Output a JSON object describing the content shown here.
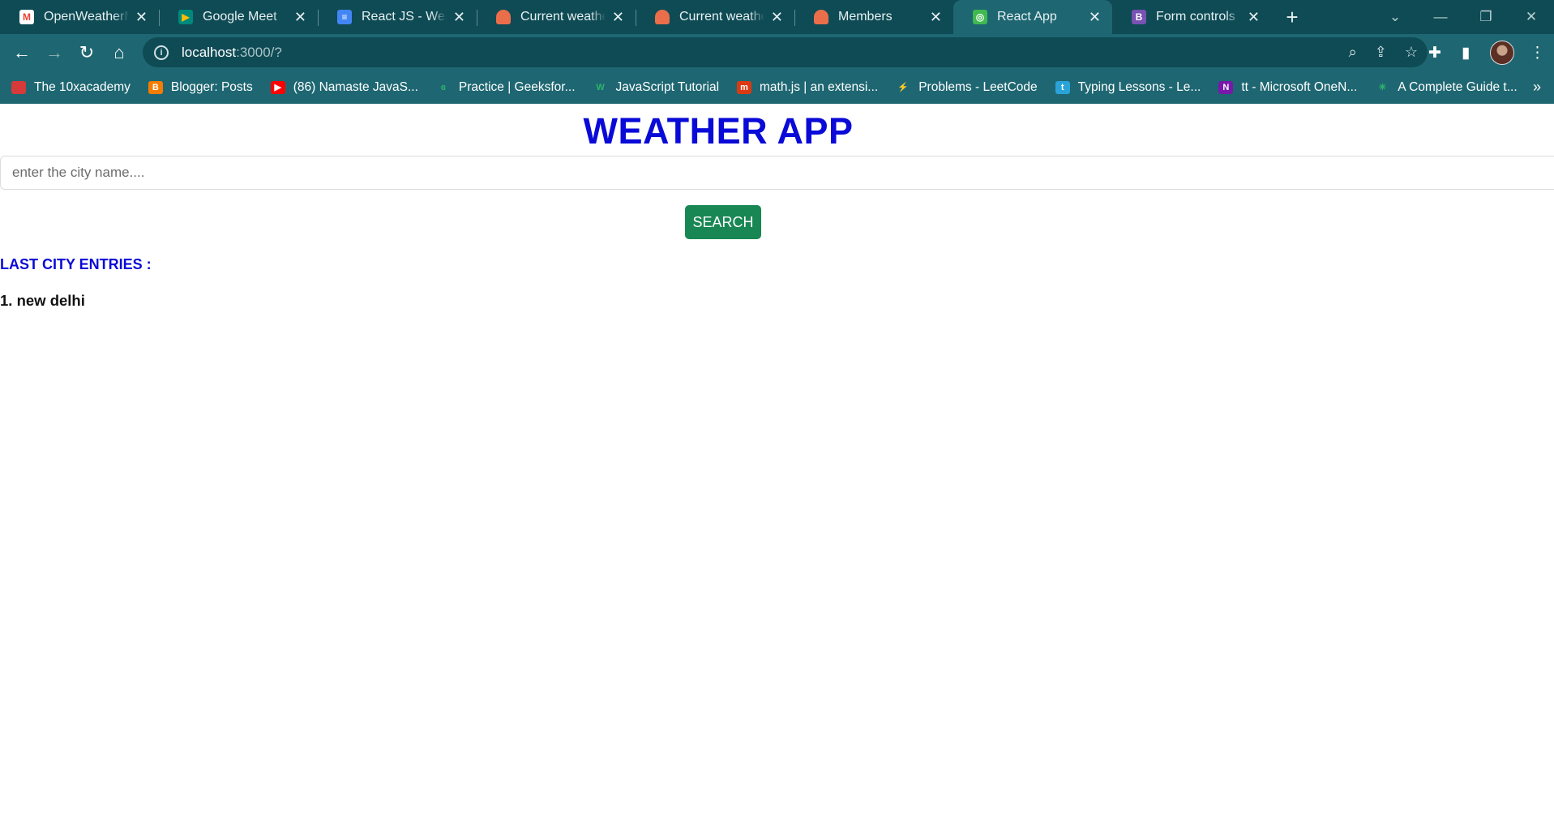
{
  "browser": {
    "tabs": [
      {
        "title": "OpenWeatherMap",
        "favicon": "gmail-icon",
        "color": "#ffffff",
        "glyph": "M",
        "glyph_color": "#ea4335",
        "active": false
      },
      {
        "title": "Google Meet",
        "favicon": "google-meet-icon",
        "color": "#00897b",
        "glyph": "▶",
        "glyph_color": "#fbbc04",
        "active": false
      },
      {
        "title": "React JS - Weather",
        "favicon": "google-docs-icon",
        "color": "#4285f4",
        "glyph": "≡",
        "glyph_color": "#ffffff",
        "active": false
      },
      {
        "title": "Current weather data",
        "favicon": "openweather-icon",
        "color": "#eb6e4b",
        "glyph": "",
        "glyph_color": "#ffffff",
        "active": false
      },
      {
        "title": "Current weather data",
        "favicon": "openweather-icon",
        "color": "#eb6e4b",
        "glyph": "",
        "glyph_color": "#ffffff",
        "active": false
      },
      {
        "title": "Members",
        "favicon": "openweather-icon",
        "color": "#eb6e4b",
        "glyph": "",
        "glyph_color": "#ffffff",
        "active": false
      },
      {
        "title": "React App",
        "favicon": "react-app-icon",
        "color": "#3fb950",
        "glyph": "◎",
        "glyph_color": "#ffffff",
        "active": true
      },
      {
        "title": "Form controls · Bootstrap",
        "favicon": "bootstrap-icon",
        "color": "#7952b3",
        "glyph": "B",
        "glyph_color": "#ffffff",
        "active": false
      }
    ],
    "url_host": "localhost",
    "url_rest": ":3000/?",
    "bookmarks": [
      {
        "label": "The 10xacademy",
        "icon": "10x-icon",
        "color": "#d73a3a",
        "glyph": ""
      },
      {
        "label": "Blogger: Posts",
        "icon": "blogger-icon",
        "color": "#f57c00",
        "glyph": "B"
      },
      {
        "label": "(86) Namaste JavaS...",
        "icon": "youtube-icon",
        "color": "#ff0000",
        "glyph": "▶"
      },
      {
        "label": "Practice | Geeksfor...",
        "icon": "geeksforgeeks-icon",
        "color": "transparent",
        "glyph": "ɞ"
      },
      {
        "label": "JavaScript Tutorial",
        "icon": "w3-icon",
        "color": "transparent",
        "glyph": "W"
      },
      {
        "label": "math.js | an extensi...",
        "icon": "mathjs-icon",
        "color": "#dc3912",
        "glyph": "m"
      },
      {
        "label": "Problems - LeetCode",
        "icon": "leetcode-icon",
        "color": "transparent",
        "glyph": "⚡"
      },
      {
        "label": "Typing Lessons - Le...",
        "icon": "typing-icon",
        "color": "#2aa3d8",
        "glyph": "t"
      },
      {
        "label": "tt - Microsoft OneN...",
        "icon": "onenote-icon",
        "color": "#7719aa",
        "glyph": "N"
      },
      {
        "label": "A Complete Guide t...",
        "icon": "css-tricks-icon",
        "color": "transparent",
        "glyph": "✳"
      }
    ]
  },
  "app": {
    "title": "WEATHER APP",
    "search_placeholder": "enter the city name....",
    "search_button": "SEARCH",
    "entries_heading": "LAST CITY ENTRIES :",
    "entries": [
      "1. new delhi"
    ]
  }
}
